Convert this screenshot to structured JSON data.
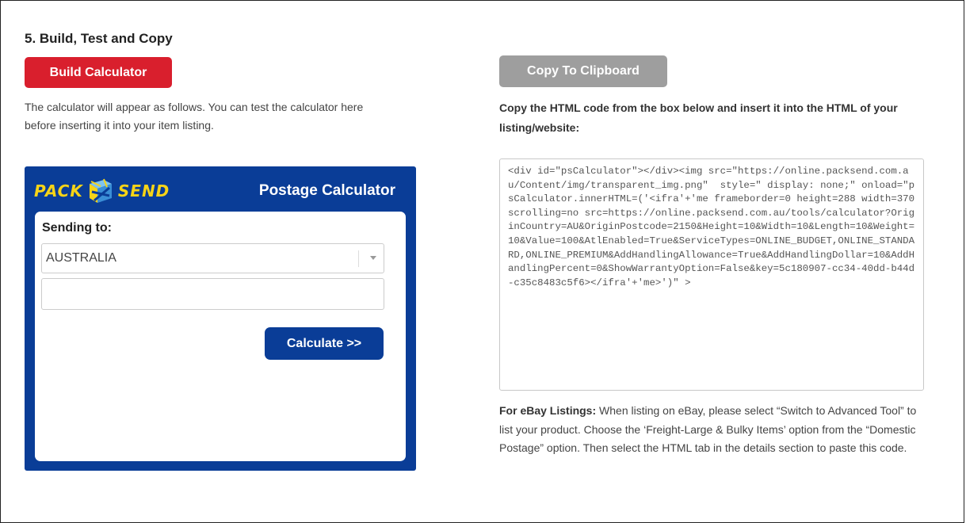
{
  "section": {
    "title": "5. Build, Test and Copy"
  },
  "buttons": {
    "build": "Build Calculator",
    "copy": "Copy To Clipboard"
  },
  "intro_text": "The calculator will appear as follows. You can test the calculator here before inserting it into your item listing.",
  "copy_instructions": "Copy the HTML code from the box below and insert it into the HTML of your listing/website:",
  "widget": {
    "logo_left": "PACK",
    "logo_right": "SEND",
    "title": "Postage Calculator",
    "sending_label": "Sending to:",
    "country": "AUSTRALIA",
    "postcode_value": "",
    "calculate_label": "Calculate >>",
    "colors": {
      "brand_blue": "#0a3d97",
      "logo_yellow": "#f7d417",
      "build_red": "#d91f2d",
      "copy_gray": "#9e9e9e"
    }
  },
  "code_snippet": "<div id=\"psCalculator\"></div><img src=\"https://online.packsend.com.au/Content/img/transparent_img.png\"  style=\" display: none;\" onload=\"psCalculator.innerHTML=('<ifra'+'me frameborder=0 height=288 width=370 scrolling=no src=https://online.packsend.com.au/tools/calculator?OriginCountry=AU&OriginPostcode=2150&Height=10&Width=10&Length=10&Weight=10&Value=100&AtlEnabled=True&ServiceTypes=ONLINE_BUDGET,ONLINE_STANDARD,ONLINE_PREMIUM&AddHandlingAllowance=True&AddHandlingDollar=10&AddHandlingPercent=0&ShowWarrantyOption=False&key=5c180907-cc34-40dd-b44d-c35c8483c5f6></ifra'+'me>')\" >",
  "ebay": {
    "label": "For eBay Listings:",
    "text": " When listing on eBay, please select “Switch to Advanced Tool” to list your product. Choose the ‘Freight-Large & Bulky Items’ option from the “Domestic Postage” option. Then select the HTML tab in the details section to paste this code."
  }
}
